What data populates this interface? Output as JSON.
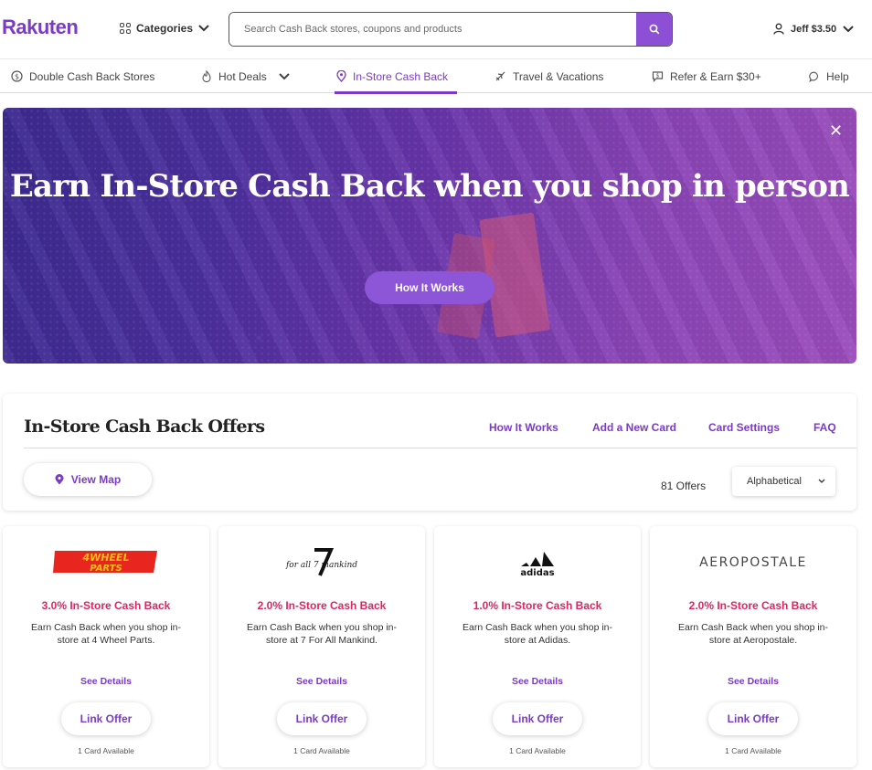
{
  "header": {
    "logo": "Rakuten",
    "categories_label": "Categories",
    "search_placeholder": "Search Cash Back stores, coupons and products",
    "user_label": "Jeff $3.50"
  },
  "nav": {
    "items": [
      {
        "label": "Double Cash Back Stores",
        "icon": "dollar-circle-icon"
      },
      {
        "label": "Hot Deals",
        "icon": "flame-icon"
      },
      {
        "label": "In-Store Cash Back",
        "icon": "location-pin-icon",
        "active": true
      },
      {
        "label": "Travel & Vacations",
        "icon": "plane-icon"
      },
      {
        "label": "Refer & Earn $30+",
        "icon": "chat-dollar-icon"
      },
      {
        "label": "Help",
        "icon": "chat-bubble-icon"
      }
    ]
  },
  "hero": {
    "headline": "Earn In-Store Cash Back when you shop in person",
    "button_label": "How It Works",
    "close_label": "✕"
  },
  "offers_panel": {
    "title": "In-Store Cash Back Offers",
    "links": [
      "How It Works",
      "Add a New Card",
      "Card Settings",
      "FAQ"
    ],
    "view_map_label": "View Map",
    "offer_count": "81 Offers",
    "sort_label": "Alphabetical"
  },
  "cards": [
    {
      "logo": "4WHEEL PARTS",
      "rate": "3.0% In-Store Cash Back",
      "description": "Earn Cash Back when you shop in-store at 4 Wheel Parts.",
      "details_label": "See Details",
      "link_label": "Link Offer",
      "availability": "1 Card Available"
    },
    {
      "logo": "for all 7 mankind",
      "rate": "2.0% In-Store Cash Back",
      "description": "Earn Cash Back when you shop in-store at 7 For All Mankind.",
      "details_label": "See Details",
      "link_label": "Link Offer",
      "availability": "1 Card Available"
    },
    {
      "logo": "adidas",
      "rate": "1.0% In-Store Cash Back",
      "description": "Earn Cash Back when you shop in-store at Adidas.",
      "details_label": "See Details",
      "link_label": "Link Offer",
      "availability": "1 Card Available"
    },
    {
      "logo": "AEROPOSTALE",
      "rate": "2.0% In-Store Cash Back",
      "description": "Earn Cash Back when you shop in-store at Aeropostale.",
      "details_label": "See Details",
      "link_label": "Link Offer",
      "availability": "1 Card Available"
    }
  ],
  "colors": {
    "brand_purple": "#7b3bc4",
    "rate_pink": "#e0245e",
    "search_button": "#8c4fd6"
  }
}
